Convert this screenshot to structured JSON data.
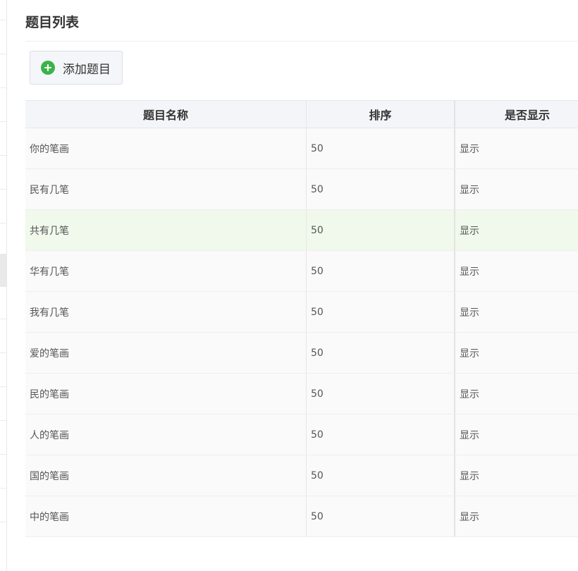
{
  "page": {
    "title": "题目列表"
  },
  "toolbar": {
    "add_label": "添加题目",
    "add_icon": "plus-circle-icon",
    "accent_color": "#3cb34a"
  },
  "table": {
    "columns": [
      "题目名称",
      "排序",
      "是否显示"
    ],
    "rows": [
      {
        "name": "你的笔画",
        "sort": "50",
        "visible": "显示"
      },
      {
        "name": "民有几笔",
        "sort": "50",
        "visible": "显示"
      },
      {
        "name": "共有几笔",
        "sort": "50",
        "visible": "显示"
      },
      {
        "name": "华有几笔",
        "sort": "50",
        "visible": "显示"
      },
      {
        "name": "我有几笔",
        "sort": "50",
        "visible": "显示"
      },
      {
        "name": "爱的笔画",
        "sort": "50",
        "visible": "显示"
      },
      {
        "name": "民的笔画",
        "sort": "50",
        "visible": "显示"
      },
      {
        "name": "人的笔画",
        "sort": "50",
        "visible": "显示"
      },
      {
        "name": "国的笔画",
        "sort": "50",
        "visible": "显示"
      },
      {
        "name": "中的笔画",
        "sort": "50",
        "visible": "显示"
      }
    ],
    "highlighted_row_color": "#f0f9eb"
  }
}
